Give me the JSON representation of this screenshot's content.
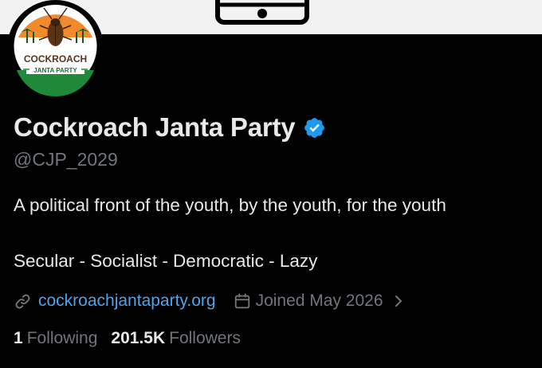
{
  "profile": {
    "display_name": "Cockroach Janta Party",
    "handle": "@CJP_2029",
    "bio": "A political front of the youth, by the youth, for the youth",
    "tagline": "Secular - Socialist - Democratic - Lazy",
    "website": "cockroachjantaparty.org",
    "joined": "Joined May 2026",
    "following_count": "1",
    "following_label": "Following",
    "followers_count": "201.5K",
    "followers_label": "Followers",
    "verified": true
  },
  "avatar": {
    "logo_line1": "COCKROACH",
    "logo_line2": "JANTA PARTY"
  },
  "colors": {
    "background": "#000000",
    "text_primary": "#e7e9ea",
    "text_secondary": "#71767b",
    "link": "#4fa3e8",
    "verified_badge": "#1d9bf0",
    "top_band": "#f2f2f2"
  },
  "icons": {
    "verified": "verified-badge-icon",
    "link": "link-icon",
    "calendar": "calendar-icon",
    "chevron": "chevron-right-icon",
    "phone": "phone-icon"
  }
}
